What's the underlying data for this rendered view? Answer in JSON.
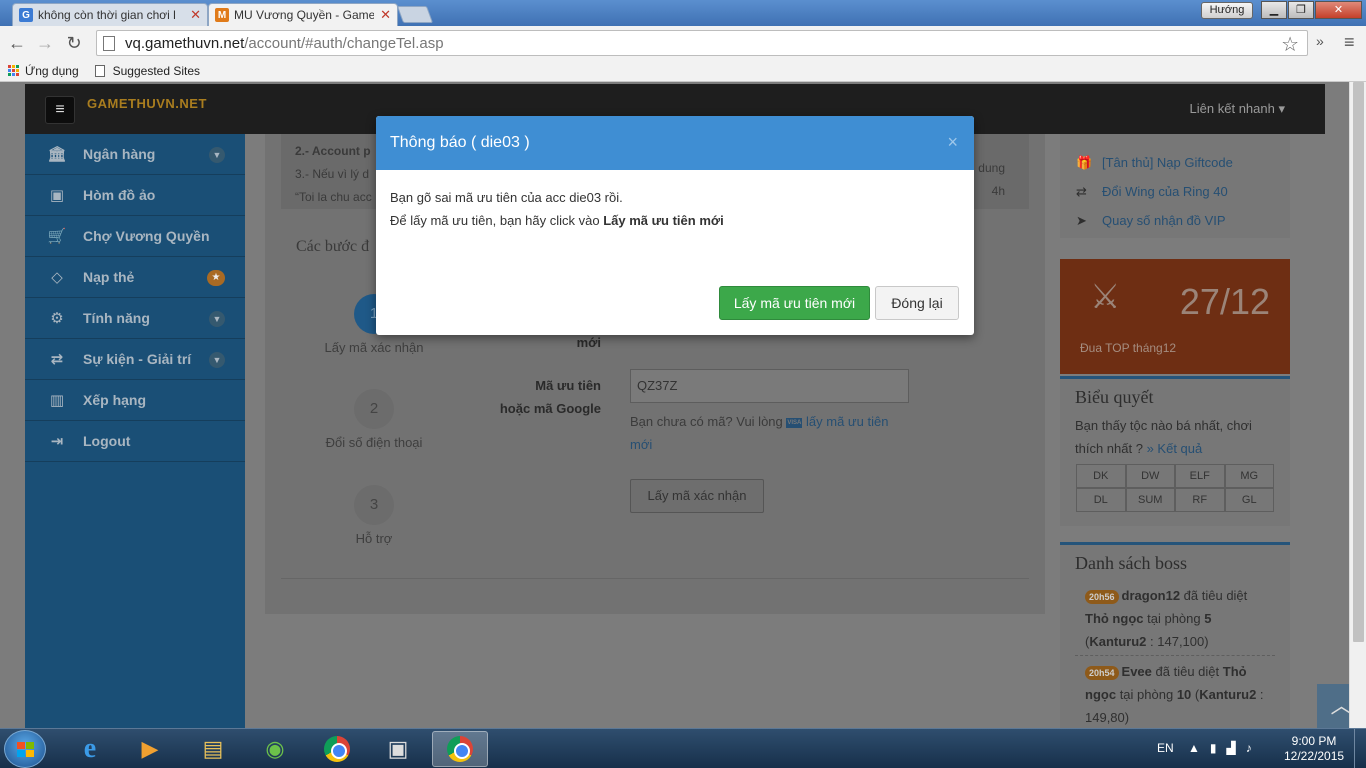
{
  "browser": {
    "tabs": [
      {
        "title": "không còn thời gian chơi l",
        "favicon": "G",
        "active": false
      },
      {
        "title": "MU Vương Quyền - Game",
        "favicon": "M",
        "active": true
      }
    ],
    "user_label": "Hướng",
    "url_host": "vq.gamethuvn.net",
    "url_path": "/account/#auth/changeTel.asp",
    "bookmarks": [
      "Ứng dụng",
      "Suggested Sites"
    ]
  },
  "topnav": {
    "logo": "GAMETHUVN.NET",
    "logo_bg": "MU",
    "quick_links": "Liên kết nhanh"
  },
  "sidebar": {
    "items": [
      {
        "label": "Ngân hàng",
        "icon": "bank-icon",
        "glyph": "🏛",
        "has_chevron": true
      },
      {
        "label": "Hòm đồ ảo",
        "icon": "briefcase-icon",
        "glyph": "💼",
        "has_chevron": false
      },
      {
        "label": "Chợ Vương Quyền",
        "icon": "cart-icon",
        "glyph": "🛒",
        "has_chevron": false
      },
      {
        "label": "Nạp thẻ",
        "icon": "diamond-icon",
        "glyph": "◇",
        "has_badge": true
      },
      {
        "label": "Tính năng",
        "icon": "gears-icon",
        "glyph": "⚙",
        "has_chevron": true
      },
      {
        "label": "Sự kiện - Giải trí",
        "icon": "random-icon",
        "glyph": "⇄",
        "has_chevron": true
      },
      {
        "label": "Xếp hạng",
        "icon": "bar-chart-icon",
        "glyph": "▮",
        "has_chevron": false
      },
      {
        "label": "Logout",
        "icon": "logout-icon",
        "glyph": "⇥",
        "has_chevron": false
      }
    ]
  },
  "main": {
    "notice_line1": "2.- Account p",
    "notice_line2": "3.- Nếu vì lý d",
    "notice_line3": "“Toi la chu acc",
    "notice_right1": "dung",
    "notice_right2": "4h",
    "steps_title": "Các bước đ",
    "steps": [
      {
        "num": "1",
        "label": "Lấy mã xác nhận"
      },
      {
        "num": "2",
        "label": "Đổi số điện thoại"
      },
      {
        "num": "3",
        "label": "Hỗ trợ"
      }
    ],
    "label_new": "mới",
    "label_code_line1": "Mã ưu tiên",
    "label_code_line2": "hoặc mã Google",
    "code_value": "QZ37Z",
    "hint_prefix": "Bạn chưa có mã? Vui lòng",
    "hint_link": "lấy mã ưu tiên mới",
    "confirm_button": "Lấy mã xác nhận"
  },
  "rightcol": {
    "quick_items": [
      {
        "label": "[Tân thủ] Nạp Giftcode",
        "icon": "gift-icon",
        "glyph": "🎁"
      },
      {
        "label": "Đổi Wing của Ring 40",
        "icon": "exchange-icon",
        "glyph": "⇄"
      },
      {
        "label": "Quay số nhận đồ VIP",
        "icon": "pointer-icon",
        "glyph": "➤"
      }
    ],
    "event_date": "27/12",
    "event_caption": "Đua TOP tháng12",
    "poll_title": "Biểu quyết",
    "poll_question": "Bạn thấy tộc nào bá nhất, chơi thích nhất ?",
    "poll_result_link": "» Kết quả",
    "poll_options": [
      "DK",
      "DW",
      "ELF",
      "MG",
      "DL",
      "SUM",
      "RF",
      "GL"
    ],
    "boss_title": "Danh sách boss",
    "boss_entries": [
      {
        "time": "20h56",
        "player": "dragon12",
        "verb": "đã tiêu diệt",
        "boss": "Thỏ ngọc",
        "room_label": "tại phòng",
        "room": "5",
        "map": "Kanturu2",
        "coords": ": 147,100)"
      },
      {
        "time": "20h54",
        "player": "Evee",
        "verb": "đã tiêu diệt",
        "boss": "Thỏ ngọc",
        "room_label": "tại phòng",
        "room": "10",
        "map": "Kanturu2",
        "coords": ": 149,80)"
      }
    ]
  },
  "modal": {
    "title": "Thông báo ( die03 )",
    "close_symbol": "×",
    "line1": "Bạn gõ sai mã ưu tiên của acc die03 rồi.",
    "line2_prefix": "Để lấy mã ưu tiên, bạn hãy click vào",
    "line2_bold": "Lấy mã ưu tiên mới",
    "primary_button": "Lấy mã ưu tiên mới",
    "close_button": "Đóng lại"
  },
  "taskbar": {
    "language": "EN",
    "time": "9:00 PM",
    "date": "12/22/2015"
  },
  "colors": {
    "modal_header": "#3f8ed3",
    "primary_button": "#3ca84a",
    "sidebar": "#1a4f76",
    "event_banner": "#6e2e13"
  }
}
